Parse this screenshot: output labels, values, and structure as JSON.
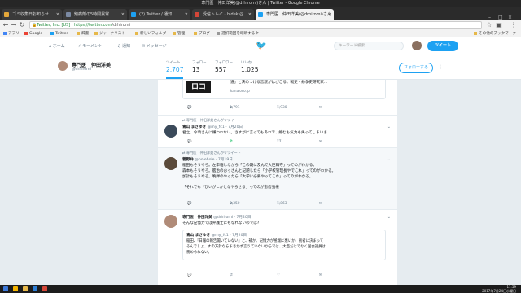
{
  "window": {
    "title": "専門医　仲田洋美(@drhiromi)さん | Twitter - Google Chrome"
  },
  "tabs": [
    {
      "label": "ゴミ収集日お知らせ"
    },
    {
      "label": "鎮痛剤の5時間異常"
    },
    {
      "label": "(2) Twitter / 通知"
    },
    {
      "label": "受信トレイ - hideki@..."
    },
    {
      "label": "専門医　仲田洋美(@drhiromi)さん"
    }
  ],
  "address": {
    "secure": "Twitter, Inc. [US]",
    "sep": " | ",
    "url_host": "https://twitter.com",
    "url_path": "/drhiromi"
  },
  "bookmarks": [
    "アプリ",
    "Google",
    "Twitter",
    "辞書",
    "ジャーナリスト",
    "新しいフォルダ",
    "管理",
    "ブログ",
    "選択範囲を印刷するクー"
  ],
  "other_bookmarks": "その他のブックマーク",
  "twnav": {
    "home": "ホーム",
    "moments": "モーメント",
    "notifications": "通知",
    "messages": "メッセージ",
    "search_placeholder": "キーワード検索",
    "tweet_button": "ツイート"
  },
  "profile": {
    "name": "専門医　仲田洋美",
    "handle": "@drhiromi",
    "stats": [
      {
        "label": "ツイート",
        "value": "2,707"
      },
      {
        "label": "フォロー",
        "value": "13"
      },
      {
        "label": "フォロワー",
        "value": "557"
      },
      {
        "label": "いいね",
        "value": "1,025"
      }
    ],
    "follow_button": "フォローする"
  },
  "tweets": [
    {
      "quote_logo": "ロコ",
      "quote_text": "道」と決めつける言説がはびこる。戦史・紛争史研究家…",
      "quote_domain": "kanaloco.jp",
      "reply": "35",
      "retweet": "1,791",
      "like": "1,930"
    },
    {
      "rt_note": "専門医　仲田洋美さんがリツイート",
      "name": "青山 まさゆき",
      "handle": "@my_fc1 · 7月20日",
      "text": "君之、今頃さんに嫌われない。さすがに言ってもあれで、絶むも気力も失ってしまいま… ",
      "reply": "2",
      "retweet": "7",
      "like": "17"
    },
    {
      "rt_note": "専門医　仲田洋美さんがリツイート",
      "name": "菅野弁",
      "handle": "@nolehole · 7月19日",
      "lines": [
        "稲田もそうやろ。左卒籍しながら「この期に及んで大臣職守」ってのがわかる。",
        "森本もそうやろ。艦治のおっさんと記題したら「小学校管理長やでこれ」ってのがわかる。",
        "加計もそうやろ。晩弾のやったら「大学に必要やってこれ」ってのがわかる。",
        "",
        "「それでも「ひいがヒかとなやらせる」ってのが恵信強権"
      ],
      "reply": "35",
      "retweet": "2,350",
      "like": "1,863"
    },
    {
      "name": "専門医　仲田洋美",
      "handle": "@drhiromi · 7月20日",
      "text": "そんな記憶力では弁護士にもなれないのでは?",
      "quote_name": "青山 まさゆき",
      "quote_handle": "@my_fc1 · 7月20日",
      "quote_lines": [
        "稲田、『日報の報告聞いていない』と、補か、記憶力が極端に悪いか、術者に決まって",
        "るんでしょ、すの方針ならまさかず言うていないからでは、大臣だけでなく国会議員は",
        "務められない。"
      ]
    }
  ],
  "taskbar": {
    "time": "11:59",
    "date": "2017年7月24日水曜日"
  }
}
